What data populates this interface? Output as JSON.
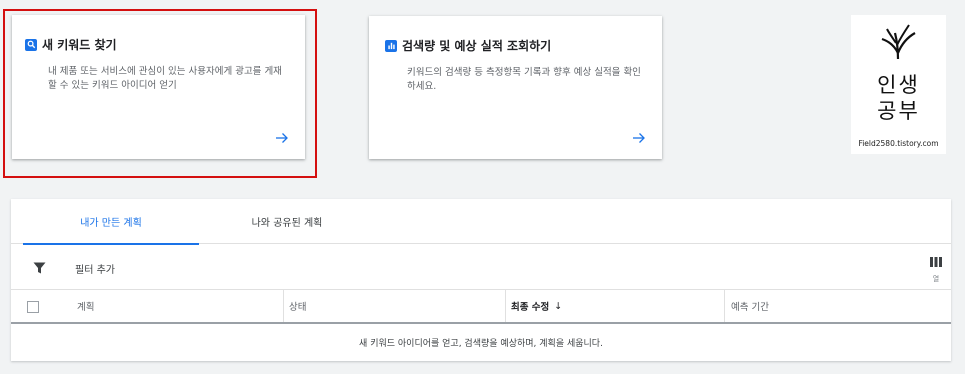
{
  "cards": [
    {
      "icon": "search-icon",
      "title": "새 키워드 찾기",
      "description": "내 제품 또는 서비스에 관심이 있는 사용자에게 광고를 게재할 수 있는 키워드 아이디어 얻기",
      "arrow_icon": "arrow-right-icon",
      "highlighted": true
    },
    {
      "icon": "bar-chart-icon",
      "title": "검색량 및 예상 실적 조회하기",
      "description": "키워드의 검색량 등 측정항목 기록과 향후 예상 실적을 확인하세요.",
      "arrow_icon": "arrow-right-icon",
      "highlighted": false
    }
  ],
  "logo": {
    "line1": "인생",
    "line2": "공부",
    "url": "Field2580.tistory.com"
  },
  "tabs": [
    {
      "label": "내가 만든 계획",
      "active": true
    },
    {
      "label": "나와 공유된 계획",
      "active": false
    }
  ],
  "filter": {
    "icon": "filter-icon",
    "label": "필터 추가"
  },
  "columns_button": {
    "icon": "columns-icon",
    "label": "열"
  },
  "table": {
    "headers": [
      "계획",
      "상태",
      "최종 수정",
      "예측 기간"
    ],
    "sort_icon": "arrow-down-icon",
    "sort_glyph": "↓",
    "empty_message": "새 키워드 아이디어를 얻고, 검색량을 예상하며, 계획을 세웁니다."
  },
  "colors": {
    "accent": "#1a73e8",
    "highlight_border": "#d40f0f",
    "background": "#f1f3f4"
  }
}
